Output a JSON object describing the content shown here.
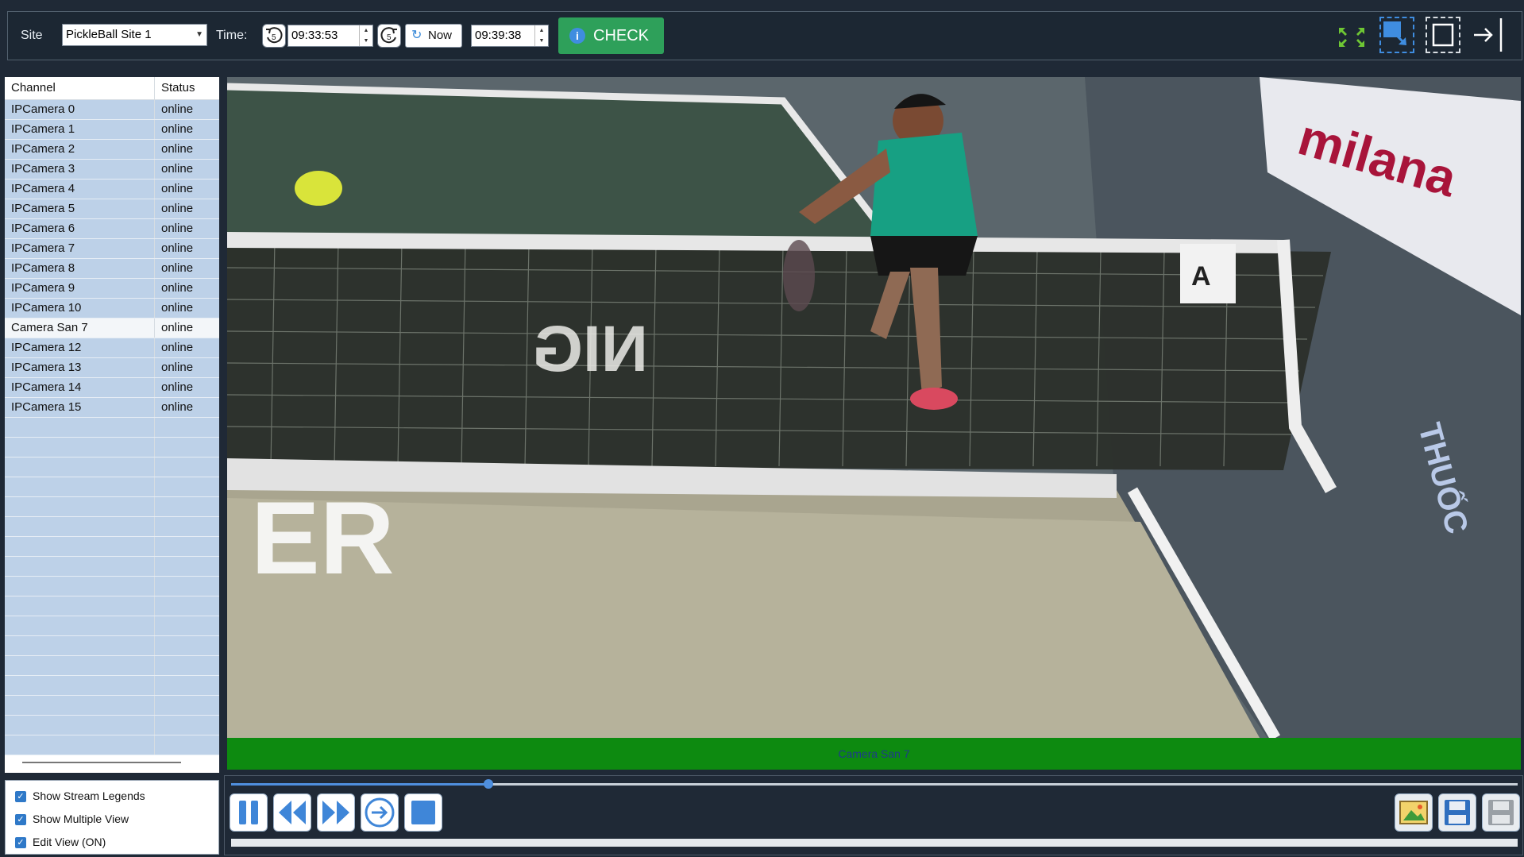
{
  "toolbar": {
    "site_label": "Site",
    "site_value": "PickleBall Site 1",
    "time_label": "Time:",
    "start_time": "09:33:53",
    "now_label": "Now",
    "end_time": "09:39:38",
    "check_label": "CHECK",
    "check_color": "#2ea05a"
  },
  "channels": {
    "header_channel": "Channel",
    "header_status": "Status",
    "rows": [
      {
        "name": "IPCamera 0",
        "status": "online"
      },
      {
        "name": "IPCamera 1",
        "status": "online"
      },
      {
        "name": "IPCamera 2",
        "status": "online"
      },
      {
        "name": "IPCamera 3",
        "status": "online"
      },
      {
        "name": "IPCamera 4",
        "status": "online"
      },
      {
        "name": "IPCamera 5",
        "status": "online"
      },
      {
        "name": "IPCamera 6",
        "status": "online"
      },
      {
        "name": "IPCamera 7",
        "status": "online"
      },
      {
        "name": "IPCamera 8",
        "status": "online"
      },
      {
        "name": "IPCamera 9",
        "status": "online"
      },
      {
        "name": "IPCamera 10",
        "status": "online"
      },
      {
        "name": "Camera San 7",
        "status": "online",
        "selected": true
      },
      {
        "name": "IPCamera 12",
        "status": "online"
      },
      {
        "name": "IPCamera 13",
        "status": "online"
      },
      {
        "name": "IPCamera 14",
        "status": "online"
      },
      {
        "name": "IPCamera 15",
        "status": "online"
      }
    ]
  },
  "options": {
    "show_stream_legends": "Show Stream Legends",
    "show_multiple_view": "Show Multiple View",
    "edit_view": "Edit View (ON)"
  },
  "video": {
    "legend_text": "Camera San 7",
    "banner_text": "milana",
    "floor_text": "ER",
    "reversed_text": "NIG",
    "side_text": "THUỐC"
  },
  "player": {
    "seek_progress": 0.2
  },
  "colors": {
    "background": "#1f2936",
    "legend_bar": "#0d8a10",
    "row_bg": "#bdd1e8",
    "accent": "#4f8fde"
  },
  "icons": {
    "undo": "rotate-left-5-icon",
    "redo": "rotate-right-5-icon",
    "refresh": "refresh-icon",
    "info": "info-icon",
    "expand": "expand-arrows-icon",
    "restore": "restore-window-icon",
    "fullscreen": "fullscreen-icon",
    "exit": "exit-arrow-icon",
    "pause": "pause-icon",
    "rewind": "rewind-icon",
    "forward": "fast-forward-icon",
    "goto": "goto-arrow-icon",
    "stop": "stop-icon",
    "snapshot": "snapshot-icon",
    "save": "save-icon",
    "save_disabled": "save-disabled-icon"
  }
}
